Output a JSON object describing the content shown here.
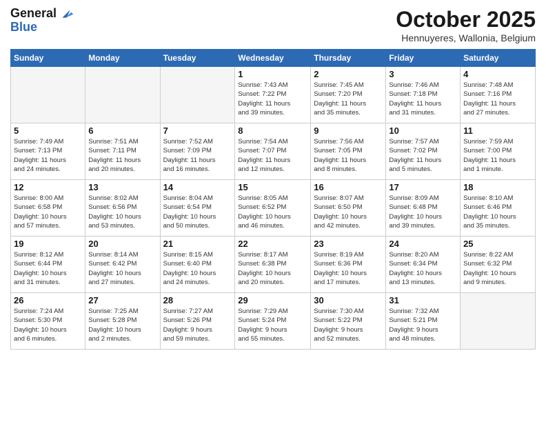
{
  "header": {
    "logo_line1": "General",
    "logo_line2": "Blue",
    "month": "October 2025",
    "location": "Hennuyeres, Wallonia, Belgium"
  },
  "days_of_week": [
    "Sunday",
    "Monday",
    "Tuesday",
    "Wednesday",
    "Thursday",
    "Friday",
    "Saturday"
  ],
  "weeks": [
    [
      {
        "day": "",
        "info": ""
      },
      {
        "day": "",
        "info": ""
      },
      {
        "day": "",
        "info": ""
      },
      {
        "day": "1",
        "info": "Sunrise: 7:43 AM\nSunset: 7:22 PM\nDaylight: 11 hours\nand 39 minutes."
      },
      {
        "day": "2",
        "info": "Sunrise: 7:45 AM\nSunset: 7:20 PM\nDaylight: 11 hours\nand 35 minutes."
      },
      {
        "day": "3",
        "info": "Sunrise: 7:46 AM\nSunset: 7:18 PM\nDaylight: 11 hours\nand 31 minutes."
      },
      {
        "day": "4",
        "info": "Sunrise: 7:48 AM\nSunset: 7:16 PM\nDaylight: 11 hours\nand 27 minutes."
      }
    ],
    [
      {
        "day": "5",
        "info": "Sunrise: 7:49 AM\nSunset: 7:13 PM\nDaylight: 11 hours\nand 24 minutes."
      },
      {
        "day": "6",
        "info": "Sunrise: 7:51 AM\nSunset: 7:11 PM\nDaylight: 11 hours\nand 20 minutes."
      },
      {
        "day": "7",
        "info": "Sunrise: 7:52 AM\nSunset: 7:09 PM\nDaylight: 11 hours\nand 16 minutes."
      },
      {
        "day": "8",
        "info": "Sunrise: 7:54 AM\nSunset: 7:07 PM\nDaylight: 11 hours\nand 12 minutes."
      },
      {
        "day": "9",
        "info": "Sunrise: 7:56 AM\nSunset: 7:05 PM\nDaylight: 11 hours\nand 8 minutes."
      },
      {
        "day": "10",
        "info": "Sunrise: 7:57 AM\nSunset: 7:02 PM\nDaylight: 11 hours\nand 5 minutes."
      },
      {
        "day": "11",
        "info": "Sunrise: 7:59 AM\nSunset: 7:00 PM\nDaylight: 11 hours\nand 1 minute."
      }
    ],
    [
      {
        "day": "12",
        "info": "Sunrise: 8:00 AM\nSunset: 6:58 PM\nDaylight: 10 hours\nand 57 minutes."
      },
      {
        "day": "13",
        "info": "Sunrise: 8:02 AM\nSunset: 6:56 PM\nDaylight: 10 hours\nand 53 minutes."
      },
      {
        "day": "14",
        "info": "Sunrise: 8:04 AM\nSunset: 6:54 PM\nDaylight: 10 hours\nand 50 minutes."
      },
      {
        "day": "15",
        "info": "Sunrise: 8:05 AM\nSunset: 6:52 PM\nDaylight: 10 hours\nand 46 minutes."
      },
      {
        "day": "16",
        "info": "Sunrise: 8:07 AM\nSunset: 6:50 PM\nDaylight: 10 hours\nand 42 minutes."
      },
      {
        "day": "17",
        "info": "Sunrise: 8:09 AM\nSunset: 6:48 PM\nDaylight: 10 hours\nand 39 minutes."
      },
      {
        "day": "18",
        "info": "Sunrise: 8:10 AM\nSunset: 6:46 PM\nDaylight: 10 hours\nand 35 minutes."
      }
    ],
    [
      {
        "day": "19",
        "info": "Sunrise: 8:12 AM\nSunset: 6:44 PM\nDaylight: 10 hours\nand 31 minutes."
      },
      {
        "day": "20",
        "info": "Sunrise: 8:14 AM\nSunset: 6:42 PM\nDaylight: 10 hours\nand 27 minutes."
      },
      {
        "day": "21",
        "info": "Sunrise: 8:15 AM\nSunset: 6:40 PM\nDaylight: 10 hours\nand 24 minutes."
      },
      {
        "day": "22",
        "info": "Sunrise: 8:17 AM\nSunset: 6:38 PM\nDaylight: 10 hours\nand 20 minutes."
      },
      {
        "day": "23",
        "info": "Sunrise: 8:19 AM\nSunset: 6:36 PM\nDaylight: 10 hours\nand 17 minutes."
      },
      {
        "day": "24",
        "info": "Sunrise: 8:20 AM\nSunset: 6:34 PM\nDaylight: 10 hours\nand 13 minutes."
      },
      {
        "day": "25",
        "info": "Sunrise: 8:22 AM\nSunset: 6:32 PM\nDaylight: 10 hours\nand 9 minutes."
      }
    ],
    [
      {
        "day": "26",
        "info": "Sunrise: 7:24 AM\nSunset: 5:30 PM\nDaylight: 10 hours\nand 6 minutes."
      },
      {
        "day": "27",
        "info": "Sunrise: 7:25 AM\nSunset: 5:28 PM\nDaylight: 10 hours\nand 2 minutes."
      },
      {
        "day": "28",
        "info": "Sunrise: 7:27 AM\nSunset: 5:26 PM\nDaylight: 9 hours\nand 59 minutes."
      },
      {
        "day": "29",
        "info": "Sunrise: 7:29 AM\nSunset: 5:24 PM\nDaylight: 9 hours\nand 55 minutes."
      },
      {
        "day": "30",
        "info": "Sunrise: 7:30 AM\nSunset: 5:22 PM\nDaylight: 9 hours\nand 52 minutes."
      },
      {
        "day": "31",
        "info": "Sunrise: 7:32 AM\nSunset: 5:21 PM\nDaylight: 9 hours\nand 48 minutes."
      },
      {
        "day": "",
        "info": ""
      }
    ]
  ]
}
